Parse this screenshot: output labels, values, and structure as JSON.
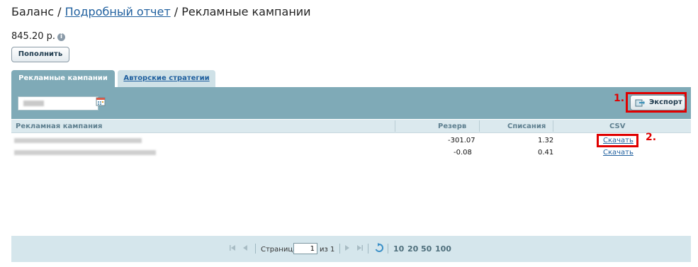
{
  "breadcrumb": {
    "home": "Баланс",
    "sep1": "/",
    "detailed_report": "Подробный отчет",
    "sep2": "/",
    "current": "Рекламные кампании"
  },
  "balance": {
    "amount": "845.20 р.",
    "info_icon": "info-icon"
  },
  "topup_button": "Пополнить",
  "tabs": [
    {
      "label": "Рекламные кампании",
      "active": true
    },
    {
      "label": "Авторские стратегии",
      "active": false
    }
  ],
  "toolbar": {
    "calendar_icon": "calendar-icon",
    "export_label": "Экспорт",
    "export_icon": "export-icon"
  },
  "annotations": {
    "step1": "1.",
    "step2": "2."
  },
  "table": {
    "columns": [
      "Рекламная кампания",
      "Резерв",
      "Списания",
      "CSV"
    ],
    "rows": [
      {
        "reserve": "-301.07",
        "spend": "1.32",
        "csv": "Скачать"
      },
      {
        "reserve": "-0.08",
        "spend": "0.41",
        "csv": "Скачать"
      }
    ]
  },
  "pager": {
    "page_label": "Страница",
    "page_value": "1",
    "of_label": "из 1",
    "sizes": [
      "10",
      "20",
      "50",
      "100"
    ]
  },
  "colors": {
    "header_bg": "#7faab7",
    "highlight": "#e00000",
    "link": "#1f5f9e"
  }
}
